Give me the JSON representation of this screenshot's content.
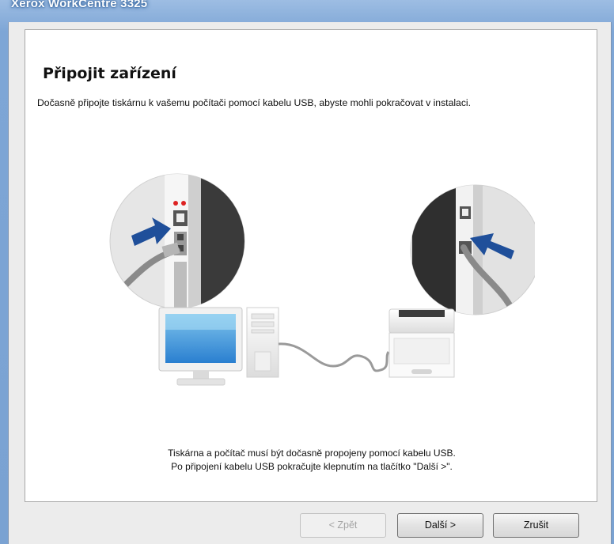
{
  "window": {
    "title": "Xerox WorkCentre 3325"
  },
  "page": {
    "heading": "Připojit zařízení",
    "instruction": "Dočasně připojte tiskárnu k vašemu počítači pomocí kabelu USB, abyste mohli pokračovat v instalaci.",
    "caption_line1": "Tiskárna a počítač musí být dočasně propojeny pomocí kabelu USB.",
    "caption_line2": "Po připojení kabelu USB pokračujte klepnutím na tlačítko \"Další >\"."
  },
  "buttons": {
    "back": "< Zpět",
    "next": "Další >",
    "cancel": "Zrušit"
  },
  "colors": {
    "arrow": "#1f4f9a",
    "title_glow": "#1b4f8e"
  }
}
